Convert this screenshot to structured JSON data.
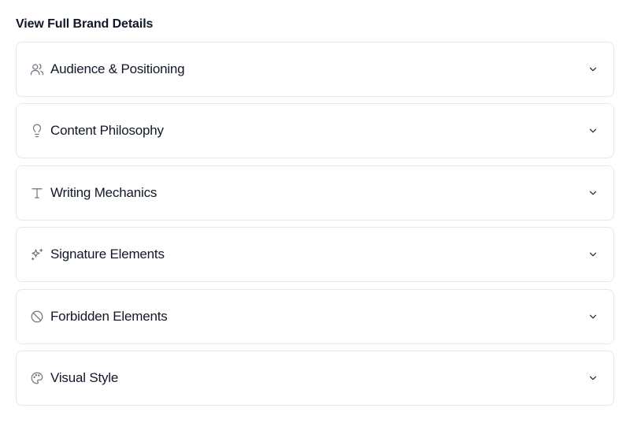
{
  "heading": "View Full Brand Details",
  "sections": [
    {
      "label": "Audience & Positioning",
      "icon": "users-icon"
    },
    {
      "label": "Content Philosophy",
      "icon": "lightbulb-icon"
    },
    {
      "label": "Writing Mechanics",
      "icon": "type-icon"
    },
    {
      "label": "Signature Elements",
      "icon": "sparkles-icon"
    },
    {
      "label": "Forbidden Elements",
      "icon": "ban-icon"
    },
    {
      "label": "Visual Style",
      "icon": "palette-icon"
    }
  ],
  "colors": {
    "border": "#e5e7eb",
    "icon": "#6b7280",
    "text": "#111827"
  }
}
